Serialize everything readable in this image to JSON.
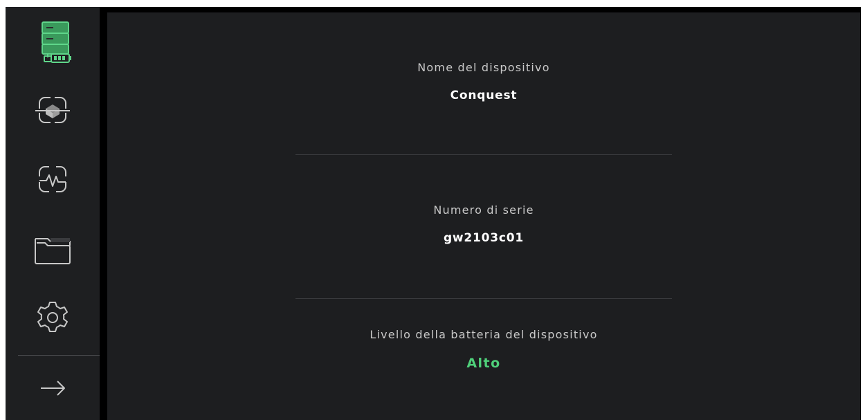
{
  "sidebar": {
    "items": [
      {
        "icon": "device-battery-icon",
        "active": true
      },
      {
        "icon": "scan-object-icon",
        "active": false
      },
      {
        "icon": "scan-activity-icon",
        "active": false
      },
      {
        "icon": "folder-icon",
        "active": false
      },
      {
        "icon": "gear-icon",
        "active": false
      }
    ],
    "footer_icon": "arrow-right-icon"
  },
  "device_info": {
    "name_label": "Nome del dispositivo",
    "name_value": "Conquest",
    "serial_label": "Numero di serie",
    "serial_value": "gw2103c01",
    "battery_label": "Livello della batteria del dispositivo",
    "battery_value": "Alto"
  },
  "colors": {
    "accent_green": "#4fd07a",
    "sidebar_bg": "#1e1f21",
    "main_bg": "#1d1e20",
    "icon_stroke": "#c8c8c8"
  }
}
